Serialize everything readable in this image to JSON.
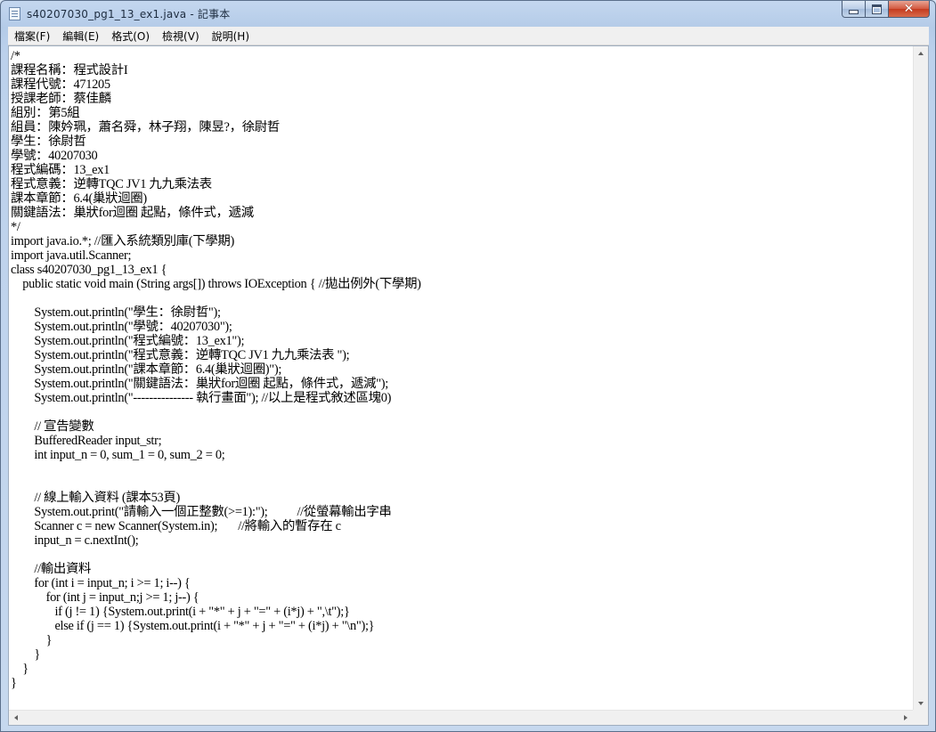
{
  "window": {
    "title": "s40207030_pg1_13_ex1.java - 記事本"
  },
  "menu": [
    {
      "label": "檔案(F)"
    },
    {
      "label": "編輯(E)"
    },
    {
      "label": "格式(O)"
    },
    {
      "label": "檢視(V)"
    },
    {
      "label": "說明(H)"
    }
  ],
  "editor": {
    "lines": [
      "/*",
      "課程名稱：程式設計I",
      "課程代號：471205",
      "授課老師：蔡佳麟",
      "組別：第5組",
      "組員：陳妗珮，蕭名舜，林子翔，陳昱?，徐尉哲",
      "學生：徐尉哲",
      "學號：40207030",
      "程式編碼：13_ex1",
      "程式意義：逆轉TQC JV1 九九乘法表",
      "課本章節：6.4(巢狀迴圈)",
      "關鍵語法：巢狀for迴圈 起點，條件式，遞減",
      "*/",
      "import java.io.*; //匯入系統類別庫(下學期)",
      "import java.util.Scanner;",
      "class s40207030_pg1_13_ex1 {",
      "    public static void main (String args[]) throws IOException { //拋出例外(下學期)",
      "",
      "        System.out.println(\"學生：徐尉哲\");",
      "        System.out.println(\"學號：40207030\");",
      "        System.out.println(\"程式編號：13_ex1\");",
      "        System.out.println(\"程式意義：逆轉TQC JV1 九九乘法表 \");",
      "        System.out.println(\"課本章節：6.4(巢狀迴圈)\");",
      "        System.out.println(\"關鍵語法：巢狀for迴圈 起點，條件式，遞減\");",
      "        System.out.println(\"--------------- 執行畫面\"); //以上是程式敘述區塊0)",
      "",
      "        // 宣告變數",
      "        BufferedReader input_str;",
      "        int input_n = 0, sum_1 = 0, sum_2 = 0;",
      "",
      "",
      "        // 線上輸入資料 (課本53頁)",
      "        System.out.print(\"請輸入一個正整數(>=1):\");          //從螢幕輸出字串",
      "        Scanner c = new Scanner(System.in);       //將輸入的暫存在 c",
      "        input_n = c.nextInt();",
      "",
      "        //輸出資料",
      "        for (int i = input_n; i >= 1; i--) {",
      "            for (int j = input_n;j >= 1; j--) {",
      "               if (j != 1) {System.out.print(i + \"*\" + j + \"=\" + (i*j) + \",\\t\");}",
      "               else if (j == 1) {System.out.print(i + \"*\" + j + \"=\" + (i*j) + \"\\n\");}",
      "            }",
      "        }",
      "    }",
      "}"
    ]
  }
}
